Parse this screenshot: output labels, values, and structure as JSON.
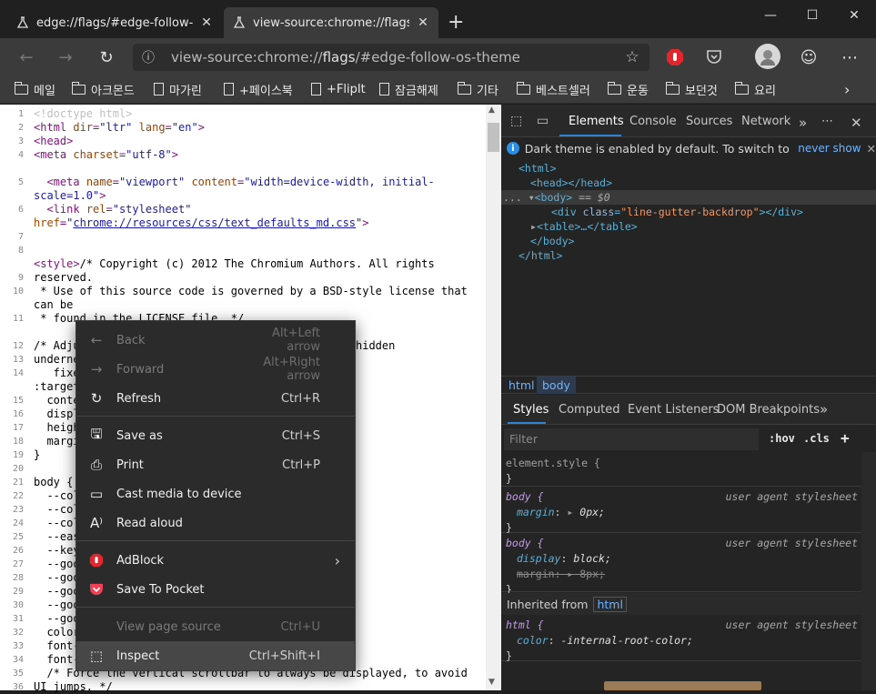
{
  "tabs": [
    {
      "title": "edge://flags/#edge-follow-os-the",
      "active": false
    },
    {
      "title": "view-source:chrome://flags/#edg",
      "active": true
    }
  ],
  "window_controls": {
    "minimize": "—",
    "maximize": "☐",
    "close": "✕"
  },
  "address_bar": {
    "prefix": "view-source:chrome://",
    "host": "flags",
    "suffix": "/#edge-follow-os-theme"
  },
  "favorites": [
    "메일",
    "아크몬드",
    "마가린",
    "+페이스북",
    "+FlipIt",
    "잠금해제",
    "기타",
    "베스트셀러",
    "운동",
    "보던것",
    "요리"
  ],
  "source": {
    "line_numbers": [
      "1",
      "2",
      "3",
      "4",
      "",
      "5",
      "",
      "6",
      "",
      "7",
      "8",
      "",
      "9",
      "10",
      "",
      "11",
      "",
      "12",
      "13",
      "14",
      "",
      "15",
      "16",
      "17",
      "18",
      "19",
      "20",
      "21",
      "22",
      "23",
      "24",
      "25",
      "26",
      "27",
      "28",
      "29",
      "30",
      "31",
      "32",
      "33",
      "34",
      "35",
      "36",
      "37",
      ""
    ],
    "lines": [
      {
        "t": "doct",
        "s": "<!doctype html>"
      },
      {
        "t": "html",
        "s": "<html dir=\"ltr\" lang=\"en\">"
      },
      {
        "t": "tag",
        "s": "<head>"
      },
      {
        "t": "meta",
        "s": "<meta charset=\"utf-8\">"
      },
      {
        "t": "blank",
        "s": ""
      },
      {
        "t": "meta2",
        "s": "  <meta name=\"viewport\" content=\"width=device-width, initial-"
      },
      {
        "t": "val",
        "s": "scale=1.0\">"
      },
      {
        "t": "link1",
        "s": "  <link rel=\"stylesheet\""
      },
      {
        "t": "link2",
        "s": "href=\"chrome://resources/css/text_defaults_md.css\">"
      },
      {
        "t": "blank",
        "s": ""
      },
      {
        "t": "blank",
        "s": ""
      },
      {
        "t": "style",
        "s": "<style>/* Copyright (c) 2012 The Chromium Authors. All rights"
      },
      {
        "t": "plain",
        "s": "reserved."
      },
      {
        "t": "plain",
        "s": " * Use of this source code is governed by a BSD-style license that"
      },
      {
        "t": "plain",
        "s": "can be"
      },
      {
        "t": "plain",
        "s": " * found in the LICENSE file. */"
      },
      {
        "t": "blank",
        "s": ""
      },
      {
        "t": "plain",
        "s": "/* Adju                                    ly be hidden"
      },
      {
        "t": "plain",
        "s": "underne"
      },
      {
        "t": "plain",
        "s": "   fixe"
      },
      {
        "t": "plain",
        "s": ":target"
      },
      {
        "t": "plain",
        "s": "  conte"
      },
      {
        "t": "plain",
        "s": "  displ"
      },
      {
        "t": "plain",
        "s": "  heigh"
      },
      {
        "t": "plain",
        "s": "  margi"
      },
      {
        "t": "plain",
        "s": "}"
      },
      {
        "t": "blank",
        "s": ""
      },
      {
        "t": "plain",
        "s": "body {"
      },
      {
        "t": "plain",
        "s": "  --col"
      },
      {
        "t": "plain",
        "s": "  --col"
      },
      {
        "t": "plain",
        "s": "  --col"
      },
      {
        "t": "plain",
        "s": "  --eas"
      },
      {
        "t": "plain",
        "s": "  --key"
      },
      {
        "t": "plain",
        "s": "  --goo"
      },
      {
        "t": "plain",
        "s": "  --goo"
      },
      {
        "t": "plain",
        "s": "  --goo"
      },
      {
        "t": "plain",
        "s": "  --goo"
      },
      {
        "t": "plain",
        "s": "  --goo"
      },
      {
        "t": "plain",
        "s": "  color"
      },
      {
        "t": "plain",
        "s": "  font-"
      },
      {
        "t": "plain",
        "s": "  font-"
      },
      {
        "t": "plain",
        "s": "  /* Force the vertical scrollbar to always be displayed, to avoid"
      },
      {
        "t": "plain",
        "s": "UI jumps. */"
      }
    ]
  },
  "context_menu": [
    {
      "label": "Back",
      "shortcut": "Alt+Left arrow",
      "icon": "arrow-left-icon",
      "disabled": true
    },
    {
      "label": "Forward",
      "shortcut": "Alt+Right arrow",
      "icon": "arrow-right-icon",
      "disabled": true
    },
    {
      "label": "Refresh",
      "shortcut": "Ctrl+R",
      "icon": "refresh-icon",
      "disabled": false
    },
    {
      "label": "Save as",
      "shortcut": "Ctrl+S",
      "icon": "save-icon",
      "disabled": false
    },
    {
      "label": "Print",
      "shortcut": "Ctrl+P",
      "icon": "print-icon",
      "disabled": false
    },
    {
      "label": "Cast media to device",
      "shortcut": "",
      "icon": "cast-icon",
      "disabled": false
    },
    {
      "label": "Read aloud",
      "shortcut": "",
      "icon": "read-aloud-icon",
      "disabled": false
    },
    {
      "label": "AdBlock",
      "shortcut": "›",
      "icon": "adblock-icon",
      "disabled": false
    },
    {
      "label": "Save To Pocket",
      "shortcut": "",
      "icon": "pocket-icon",
      "disabled": false
    },
    {
      "label": "View page source",
      "shortcut": "Ctrl+U",
      "icon": "",
      "disabled": true
    },
    {
      "label": "Inspect",
      "shortcut": "Ctrl+Shift+I",
      "icon": "inspect-icon",
      "disabled": false,
      "highlighted": true
    }
  ],
  "devtools": {
    "tabs": [
      "Elements",
      "Console",
      "Sources",
      "Network"
    ],
    "info": "Dark theme is enabled by default. To switch to the lig...",
    "info_link": "never show",
    "dom": {
      "html_open": "<html>",
      "head": "<head></head>",
      "body_open": "<body>",
      "body_marker": "== $0",
      "div_tag": "<div ",
      "div_attr": "class",
      "div_val": "\"line-gutter-backdrop\"",
      "div_close": "></div>",
      "table": "<table>…</table>",
      "body_close": "</body>",
      "html_close": "</html>"
    },
    "breadcrumbs": [
      "html",
      "body"
    ],
    "subtabs": [
      "Styles",
      "Computed",
      "Event Listeners",
      "DOM Breakpoints"
    ],
    "filter_placeholder": "Filter",
    "hov": ":hov",
    "cls": ".cls",
    "rules": {
      "element_style": "element.style {",
      "close": "}",
      "ua": "user agent stylesheet",
      "body1_sel": "body {",
      "body1_prop": "margin",
      "body1_val": "0px;",
      "body2_sel": "body {",
      "body2_prop1": "display",
      "body2_val1": "block;",
      "body2_prop2": "margin",
      "body2_val2": "8px;",
      "inherited": "Inherited from",
      "inherited_el": "html",
      "html_sel": "html {",
      "html_prop": "color",
      "html_val": "-internal-root-color;"
    }
  }
}
